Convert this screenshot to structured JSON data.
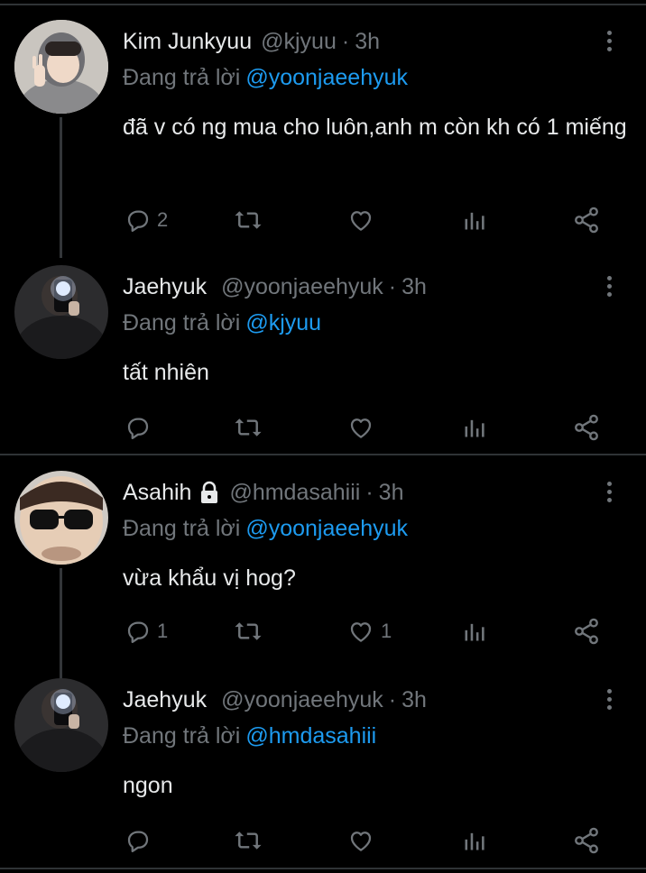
{
  "colors": {
    "background": "#000000",
    "text": "#e7e9ea",
    "muted": "#71767b",
    "link": "#1d9bf0",
    "divider": "#2f3336"
  },
  "replying_prefix": "Đang trả lời",
  "tweets": [
    {
      "name": "Kim Junkyuu",
      "handle": "@kjyuu",
      "time": "3h",
      "reply_to": "@yoonjaeehyuk",
      "text": "đã v có ng mua cho luôn,anh m còn kh có 1 miếng",
      "replies": "2",
      "retweets": "",
      "likes": "",
      "avatar": "avatar-gray-hoodie-peace-sign",
      "locked": false
    },
    {
      "name": "Jaehyuk",
      "handle": "@yoonjaeehyuk",
      "time": "3h",
      "reply_to": "@kjyuu",
      "text": "tất nhiên",
      "replies": "",
      "retweets": "",
      "likes": "",
      "avatar": "avatar-mirror-selfie",
      "locked": false
    },
    {
      "name": "Asahih",
      "handle": "@hmdasahiii",
      "time": "3h",
      "reply_to": "@yoonjaeehyuk",
      "text": "vừa khẩu vị hog?",
      "replies": "1",
      "retweets": "",
      "likes": "1",
      "avatar": "avatar-glasses-closeup",
      "locked": true
    },
    {
      "name": "Jaehyuk",
      "handle": "@yoonjaeehyuk",
      "time": "3h",
      "reply_to": "@hmdasahiii",
      "text": "ngon",
      "replies": "",
      "retweets": "",
      "likes": "",
      "avatar": "avatar-mirror-selfie",
      "locked": false
    }
  ],
  "icons": [
    "reply-icon",
    "retweet-icon",
    "like-icon",
    "analytics-icon",
    "share-icon",
    "more-icon",
    "lock-icon"
  ]
}
